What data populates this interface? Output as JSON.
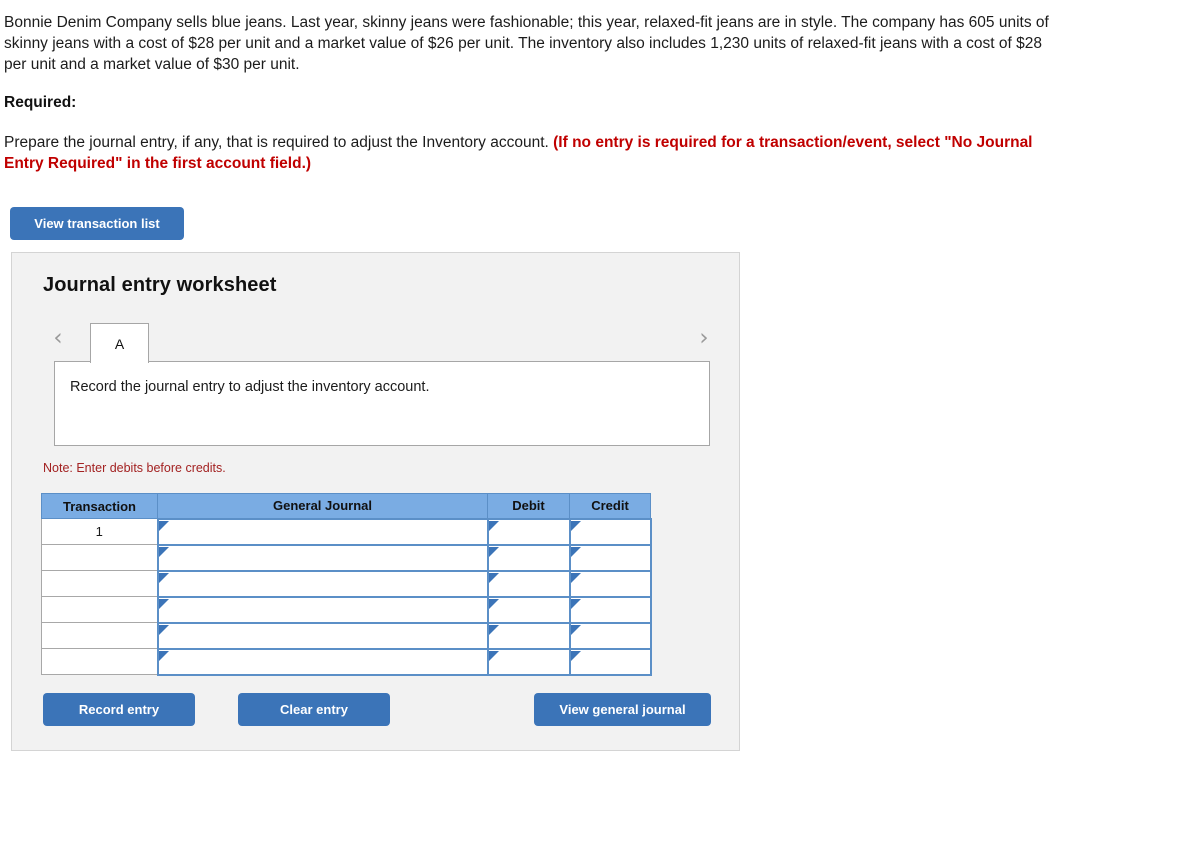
{
  "problem": {
    "text": "Bonnie Denim Company sells blue jeans. Last year, skinny jeans were fashionable; this year, relaxed-fit jeans are in style. The company has 605 units of skinny jeans with a cost of $28 per unit and a market value of $26 per unit. The inventory also includes 1,230 units of relaxed-fit jeans with a cost of $28 per unit and a market value of $30 per unit."
  },
  "required": {
    "label": "Required:",
    "instruction": "Prepare the journal entry, if any, that is required to adjust the Inventory account.",
    "warning": "(If no entry is required for a transaction/event, select \"No Journal Entry Required\" in the first account field.)"
  },
  "toolbar": {
    "view_transaction_list_label": "View transaction list"
  },
  "worksheet": {
    "title": "Journal entry worksheet",
    "prev_icon": "‹",
    "next_icon": "›",
    "tabs": [
      {
        "label": "A",
        "active": true
      }
    ],
    "prompt": "Record the journal entry to adjust the inventory account.",
    "note": "Note: Enter debits before credits.",
    "table": {
      "headers": [
        "Transaction",
        "General Journal",
        "Debit",
        "Credit"
      ],
      "rows": [
        {
          "transaction": "1",
          "general_journal": "",
          "debit": "",
          "credit": ""
        },
        {
          "transaction": "",
          "general_journal": "",
          "debit": "",
          "credit": ""
        },
        {
          "transaction": "",
          "general_journal": "",
          "debit": "",
          "credit": ""
        },
        {
          "transaction": "",
          "general_journal": "",
          "debit": "",
          "credit": ""
        },
        {
          "transaction": "",
          "general_journal": "",
          "debit": "",
          "credit": ""
        },
        {
          "transaction": "",
          "general_journal": "",
          "debit": "",
          "credit": ""
        }
      ]
    },
    "actions": {
      "record_entry_label": "Record entry",
      "clear_entry_label": "Clear entry",
      "view_general_journal_label": "View general journal"
    }
  },
  "colors": {
    "primary_button": "#3b74b8",
    "table_header": "#7aace3",
    "cell_border": "#5b8fc7",
    "warning_red": "#c00000",
    "note_red": "#a32222",
    "panel_bg": "#f2f2f2"
  }
}
